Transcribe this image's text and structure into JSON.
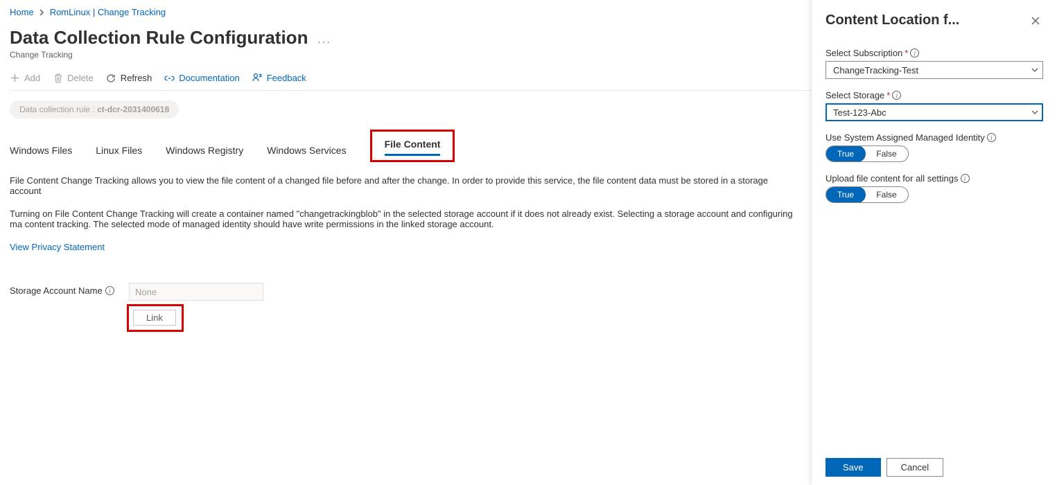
{
  "breadcrumb": {
    "home": "Home",
    "resource": "RomLinux | Change Tracking"
  },
  "header": {
    "title": "Data Collection Rule Configuration",
    "subtitle": "Change Tracking"
  },
  "toolbar": {
    "add": "Add",
    "delete": "Delete",
    "refresh": "Refresh",
    "documentation": "Documentation",
    "feedback": "Feedback"
  },
  "dcr": {
    "prefix": "Data collection rule :",
    "name": "ct-dcr-2031400618"
  },
  "tabs": {
    "windows_files": "Windows Files",
    "linux_files": "Linux Files",
    "windows_registry": "Windows Registry",
    "windows_services": "Windows Services",
    "file_content": "File Content"
  },
  "body": {
    "p1": "File Content Change Tracking allows you to view the file content of a changed file before and after the change. In order to provide this service, the file content data must be stored in a storage account",
    "p2": "Turning on File Content Change Tracking will create a container named \"changetrackingblob\" in the selected storage account if it does not already exist. Selecting a storage account and configuring ma content tracking. The selected mode of managed identity should have write permissions in the linked storage account.",
    "privacy": "View Privacy Statement",
    "storage_label": "Storage Account Name",
    "storage_value": "None",
    "link_button": "Link"
  },
  "panel": {
    "title": "Content Location f...",
    "subscription_label": "Select Subscription",
    "subscription_value": "ChangeTracking-Test",
    "storage_label": "Select Storage",
    "storage_value": "Test-123-Abc",
    "identity_label": "Use System Assigned Managed Identity",
    "upload_label": "Upload file content for all settings",
    "toggle_true": "True",
    "toggle_false": "False",
    "save": "Save",
    "cancel": "Cancel"
  }
}
